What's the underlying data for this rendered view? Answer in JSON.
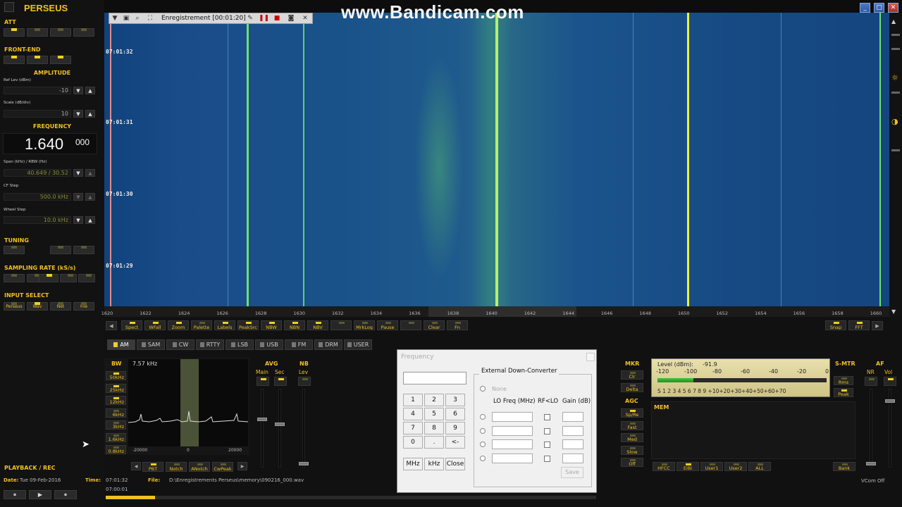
{
  "app": {
    "title": "PERSEUS"
  },
  "watermark": "www.Bandicam.com",
  "window_buttons": {
    "minimize": "_",
    "maximize": "□",
    "close": "✕"
  },
  "recorder": {
    "label": "Enregistrement [00:01:20]"
  },
  "left": {
    "att": "ATT",
    "front_end": "FRONT-END",
    "amplitude": "AMPLITUDE",
    "ref_lev_label": "Ref Lev (dBm)",
    "ref_lev_value": "-10",
    "scale_label": "Scale (dB/div)",
    "scale_value": "10",
    "frequency": "FREQUENCY",
    "freq_main": "1.640",
    "freq_sub": "000",
    "span_label": "Span (kHz) / RBW (Hz)",
    "span_value": "40.649 / 30.52",
    "cf_step_label": "CF Step",
    "cf_step_value": "500.0 kHz",
    "wheel_step_label": "Wheel Step",
    "wheel_step_value": "10.0 kHz",
    "tuning": "TUNING",
    "sampling_rate": "SAMPLING RATE (kS/s)",
    "input_select": "INPUT SELECT",
    "input_buttons": [
      "Perseus",
      "Wav",
      "Net",
      "File"
    ],
    "playback": "PLAYBACK / REC"
  },
  "waterfall": {
    "timestamps": [
      "07:01:32",
      "07:01:31",
      "07:01:30",
      "07:01:29"
    ]
  },
  "axis_ticks": [
    "1620",
    "1622",
    "1624",
    "1626",
    "1628",
    "1630",
    "1632",
    "1634",
    "1636",
    "1638",
    "1640",
    "1642",
    "1644",
    "1646",
    "1648",
    "1650",
    "1652",
    "1654",
    "1656",
    "1658",
    "1660"
  ],
  "toolbar": [
    "Spect",
    "WFall",
    "Zoom",
    "Palette",
    "Labels",
    "PeakSrc",
    "NBW",
    "NBN",
    "NBV",
    "",
    "MrkLog",
    "Pause",
    "",
    "Clear",
    "Fn"
  ],
  "toolbar_right": [
    "Snap",
    "FFT"
  ],
  "modes": [
    "AM",
    "SAM",
    "CW",
    "RTTY",
    "LSB",
    "USB",
    "FM",
    "DRM",
    "USER"
  ],
  "bw": {
    "label": "BW",
    "value": "7.57 kHz",
    "buttons": [
      "50kHz",
      "25kHz",
      "12kHz",
      "6kHz",
      "3kHz",
      "1.6kHz",
      "0.8kHz"
    ],
    "axis": [
      "-20000",
      "0",
      "20000"
    ],
    "bottom_buttons": [
      "PBT",
      "Notch",
      "ANotch",
      "CwPeak"
    ]
  },
  "avg": {
    "label": "AVG",
    "main": "Main",
    "sec": "Sec"
  },
  "nb": {
    "label": "NB",
    "lev": "Lev"
  },
  "freq_dialog": {
    "title": "Frequency",
    "keys": [
      "1",
      "2",
      "3",
      "4",
      "5",
      "6",
      "7",
      "8",
      "9",
      "0",
      ".",
      "<-"
    ],
    "unit_buttons": [
      "MHz",
      "kHz",
      "Close"
    ],
    "edc_title": "External Down-Converter",
    "none": "None",
    "col_lo": "LO Freq (MHz)",
    "col_rf": "RF<LO",
    "col_gain": "Gain (dB)",
    "save": "Save"
  },
  "mkr": {
    "label": "MKR",
    "buttons": [
      "Clr",
      "Delta"
    ]
  },
  "agc": {
    "label": "AGC",
    "buttons": [
      "Sp/Re",
      "Fast",
      "Med",
      "Slow",
      "Off"
    ]
  },
  "meter": {
    "level_label": "Level (dBm):",
    "level_value": "-91.9",
    "scale_top": [
      "-120",
      "-100",
      "-80",
      "-60",
      "-40",
      "-20",
      "0"
    ],
    "scale_bottom": "S 1 2 3 4 5 6 7 8 9 +10+20+30+40+50+60+70"
  },
  "smtr": {
    "label": "S-MTR",
    "buttons": [
      "Rms",
      "Peak"
    ]
  },
  "af": {
    "label": "AF",
    "nr": "NR",
    "vol": "Vol"
  },
  "mem": {
    "label": "MEM",
    "buttons": [
      "HFCC",
      "EiBi",
      "User1",
      "User2",
      "ALL"
    ],
    "bank": "Bank"
  },
  "status": {
    "date_label": "Date:",
    "date_value": "Tue 09-Feb-2016",
    "time_label": "Time:",
    "time_value": "07:01:32",
    "time_start": "07:00:01",
    "file_label": "File:",
    "file_value": "D:\\Enregistrements Perseus\\memory\\090216_000.wav",
    "vcom": "VCom Off"
  },
  "colors": {
    "accent": "#f0c020",
    "waterfall_base": "#1a4c8a",
    "signal": "#c8f040"
  }
}
